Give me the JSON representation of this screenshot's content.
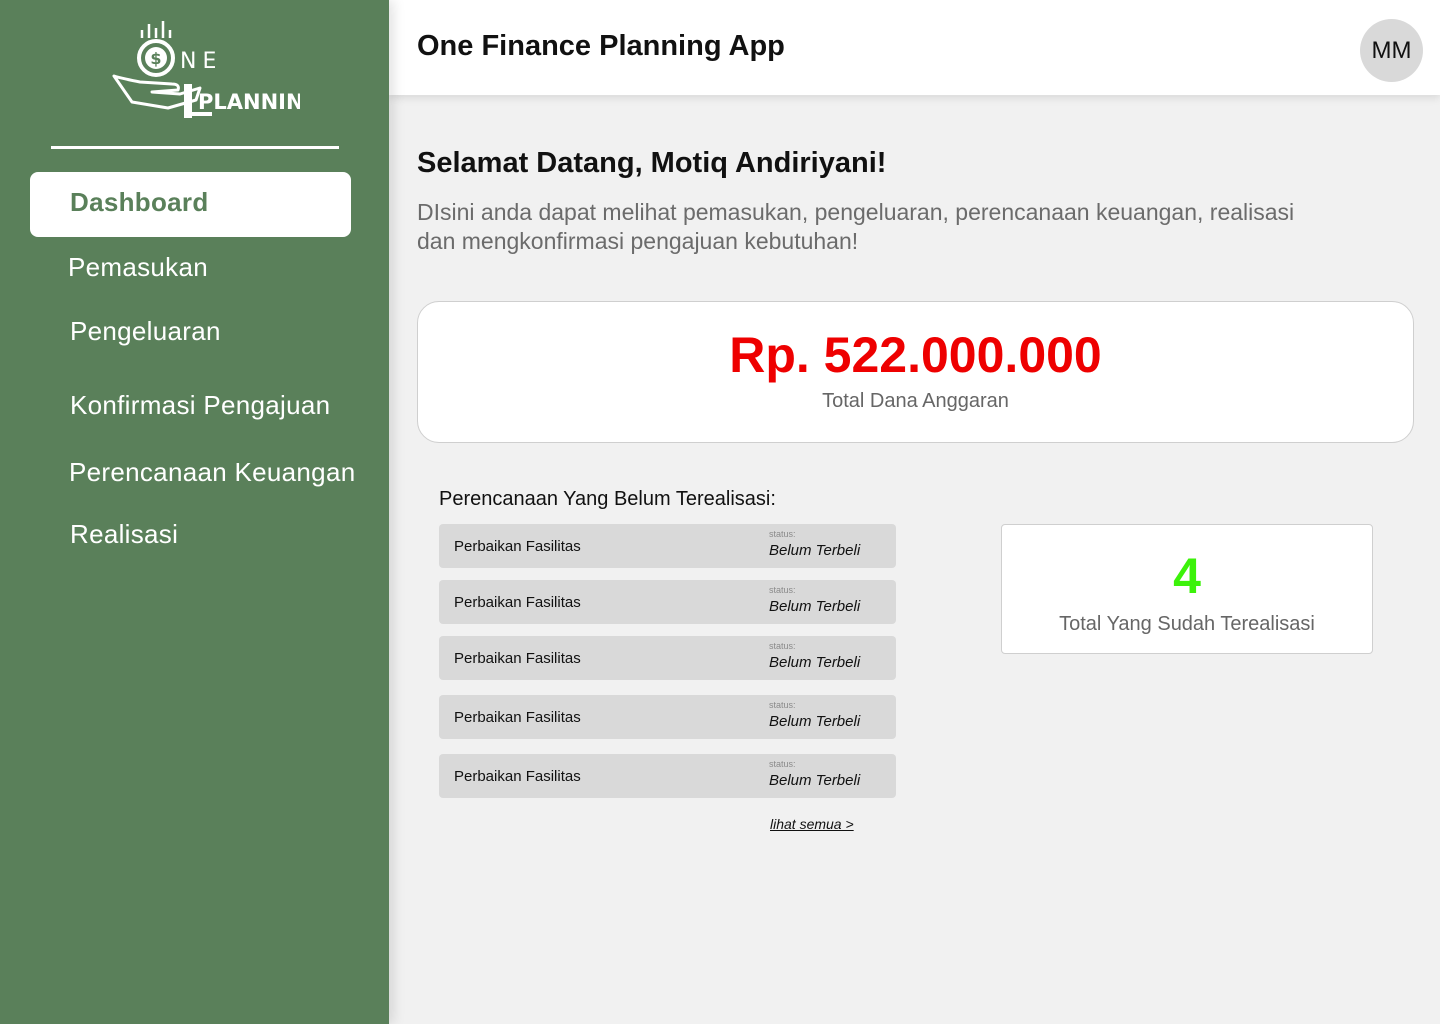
{
  "brand": {
    "logo_word_top": "NE",
    "logo_word_bottom": "PLANNING",
    "logo_letter": "O",
    "logo_symbol": "$"
  },
  "sidebar": {
    "items": [
      {
        "label": "Dashboard",
        "active": true
      },
      {
        "label": "Pemasukan"
      },
      {
        "label": "Pengeluaran"
      },
      {
        "label": "Konfirmasi Pengajuan"
      },
      {
        "label": "Perencanaan Keuangan"
      },
      {
        "label": "Realisasi"
      }
    ]
  },
  "header": {
    "title": "One Finance Planning App",
    "avatar_initials": "MM"
  },
  "main": {
    "welcome": "Selamat Datang,  Motiq Andiriyani!",
    "description": "DIsini anda dapat melihat pemasukan, pengeluaran, perencanaan keuangan, realisasi dan mengkonfirmasi pengajuan kebutuhan!",
    "budget": {
      "amount": "Rp. 522.000.000",
      "label": "Total Dana Anggaran"
    },
    "plans": {
      "title": "Perencanaan Yang Belum Terealisasi:",
      "rows": [
        {
          "name": "Perbaikan Fasilitas",
          "status_caption": "status:",
          "status": "Belum Terbeli"
        },
        {
          "name": "Perbaikan Fasilitas",
          "status_caption": "status:",
          "status": "Belum Terbeli"
        },
        {
          "name": "Perbaikan Fasilitas",
          "status_caption": "status:",
          "status": "Belum Terbeli"
        },
        {
          "name": "Perbaikan Fasilitas",
          "status_caption": "status:",
          "status": "Belum Terbeli"
        },
        {
          "name": "Perbaikan Fasilitas",
          "status_caption": "status:",
          "status": "Belum Terbeli"
        }
      ],
      "see_all": "lihat semua >"
    },
    "realized": {
      "count": "4",
      "label": "Total Yang Sudah Terealisasi"
    }
  },
  "colors": {
    "sidebar_bg": "#5a805a",
    "budget_amount": "#ee0000",
    "realized_count": "#3cf20a"
  }
}
